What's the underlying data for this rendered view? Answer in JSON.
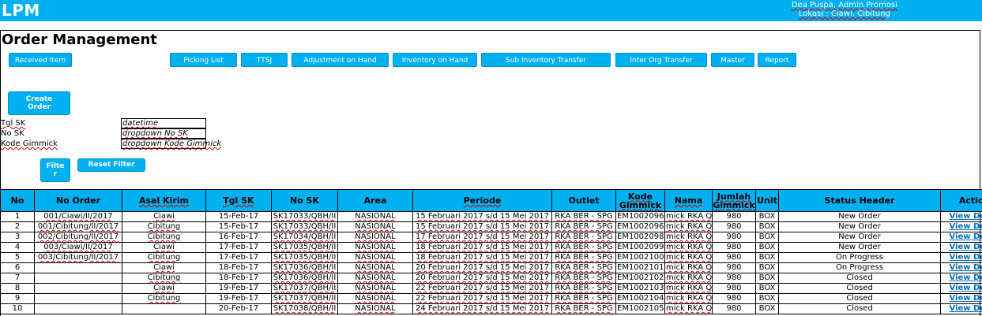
{
  "header": {
    "app_title": "LPM",
    "user_line": "Dea Puspa, Admin Promosi",
    "location_line": "Lokasi : Ciawi, Cibitung"
  },
  "page_title": "Order Management",
  "nav": {
    "received_item": "Received Item",
    "picking_list": "Picking List",
    "ttsj": "TTSJ",
    "adjustment_on_hand": "Adjustment on Hand",
    "inventory_on_hand": "Inventory on Hand",
    "sub_inventory_transfer": "Sub Inventory Transfer",
    "inter_org_transfer": "Inter Org Transfer",
    "master": "Master",
    "report": "Report"
  },
  "create_order": {
    "line1": "Create",
    "line2": "Order"
  },
  "filters": {
    "tgl_sk": {
      "label": "Tgl SK",
      "placeholder": "datetime"
    },
    "no_sk": {
      "label": "No SK",
      "placeholder": "dropdown No SK"
    },
    "kode_gimmick": {
      "label": "Kode Gimmick",
      "placeholder": "dropdown Kode Gimmick"
    },
    "filter_button": {
      "line1": "Filte",
      "line2": "r"
    },
    "reset_button": "Reset Filter"
  },
  "table": {
    "columns": {
      "no": "No",
      "no_order": "No Order",
      "asal_kirim": "Asal Kirim",
      "tgl_sk": "Tgl SK",
      "no_sk": "No SK",
      "area": "Area",
      "periode": "Periode",
      "outlet": "Outlet",
      "kode_gimmick": "Kode Gimmick",
      "nama": "Nama",
      "jumlah_gimmick": "Jumlah Gimmick",
      "unit": "Unit",
      "status_header": "Status Header",
      "action": "Action"
    },
    "rows": [
      {
        "no": "1",
        "no_order": "001/Ciawi/II/2017",
        "asal_kirim": "Ciawi",
        "tgl_sk": "15-Feb-17",
        "no_sk": "SK17033/QBH/II",
        "area": "NASIONAL",
        "periode": "15 Februari 2017 s/d 15 Mei 2017",
        "outlet": "RKA BER - SPG",
        "kode_gimmick": "EM1002096",
        "nama": "mick  RKA  Q",
        "jumlah": "980",
        "unit": "BOX",
        "status": "New Order",
        "action": "View Detail"
      },
      {
        "no": "2",
        "no_order": "001/Cibitung/II/2017",
        "asal_kirim": "Cibitung",
        "tgl_sk": "15-Feb-17",
        "no_sk": "SK17033/QBH/II",
        "area": "NASIONAL",
        "periode": "15 Februari 2017 s/d 15 Mei 2017",
        "outlet": "RKA BER - SPG",
        "kode_gimmick": "EM1002096",
        "nama": "mick  RKA  Q",
        "jumlah": "980",
        "unit": "BOX",
        "status": "New Order",
        "action": "View Detail"
      },
      {
        "no": "3",
        "no_order": "002/Cibitung/II/2017",
        "asal_kirim": "Cibitung",
        "tgl_sk": "16-Feb-17",
        "no_sk": "SK17034/QBH/II",
        "area": "NASIONAL",
        "periode": "17 Februari 2017 s/d 15 Mei 2017",
        "outlet": "RKA BER - SPG",
        "kode_gimmick": "EM1002098",
        "nama": "mick  RKA  Q",
        "jumlah": "980",
        "unit": "BOX",
        "status": "New Order",
        "action": "View Detail"
      },
      {
        "no": "4",
        "no_order": "003/Ciawi/II/2017",
        "asal_kirim": "Ciawi",
        "tgl_sk": "17-Feb-17",
        "no_sk": "SK17035/QBH/II",
        "area": "NASIONAL",
        "periode": "18 Februari 2017 s/d 15 Mei 2017",
        "outlet": "RKA BER - SPG",
        "kode_gimmick": "EM1002099",
        "nama": "mick  RKA  Q",
        "jumlah": "980",
        "unit": "BOX",
        "status": "New Order",
        "action": "View Detail"
      },
      {
        "no": "5",
        "no_order": "003/Cibitung/II/2017",
        "asal_kirim": "Cibitung",
        "tgl_sk": "17-Feb-17",
        "no_sk": "SK17035/QBH/II",
        "area": "NASIONAL",
        "periode": "18 Februari 2017 s/d 15 Mei 2017",
        "outlet": "RKA BER - SPG",
        "kode_gimmick": "EM1002100",
        "nama": "mick  RKA  Q",
        "jumlah": "980",
        "unit": "BOX",
        "status": "On Progress",
        "action": "View Detail"
      },
      {
        "no": "6",
        "no_order": "",
        "asal_kirim": "Ciawi",
        "tgl_sk": "18-Feb-17",
        "no_sk": "SK17036/QBH/II",
        "area": "NASIONAL",
        "periode": "20 Februari 2017 s/d 15 Mei 2017",
        "outlet": "RKA BER - SPG",
        "kode_gimmick": "EM1002101",
        "nama": "mick  RKA  Q",
        "jumlah": "980",
        "unit": "BOX",
        "status": "On Progress",
        "action": "View Detail"
      },
      {
        "no": "7",
        "no_order": "",
        "asal_kirim": "Cibitung",
        "tgl_sk": "18-Feb-17",
        "no_sk": "SK17036/QBH/II",
        "area": "NASIONAL",
        "periode": "20 Februari 2017 s/d 15 Mei 2017",
        "outlet": "RKA BER - SPG",
        "kode_gimmick": "EM1002102",
        "nama": "mick  RKA  Q",
        "jumlah": "980",
        "unit": "BOX",
        "status": "Closed",
        "action": "View Detail"
      },
      {
        "no": "8",
        "no_order": "",
        "asal_kirim": "Ciawi",
        "tgl_sk": "19-Feb-17",
        "no_sk": "SK17037/QBH/II",
        "area": "NASIONAL",
        "periode": "22 Februari 2017 s/d 15 Mei 2017",
        "outlet": "RKA BER - SPG",
        "kode_gimmick": "EM1002103",
        "nama": "mick  RKA  Q",
        "jumlah": "980",
        "unit": "BOX",
        "status": "Closed",
        "action": "View Detail"
      },
      {
        "no": "9",
        "no_order": "",
        "asal_kirim": "Cibitung",
        "tgl_sk": "19-Feb-17",
        "no_sk": "SK17037/QBH/II",
        "area": "NASIONAL",
        "periode": "22 Februari 2017 s/d 15 Mei 2017",
        "outlet": "RKA BER - SPG",
        "kode_gimmick": "EM1002104",
        "nama": "mick  RKA  Q",
        "jumlah": "980",
        "unit": "BOX",
        "status": "Closed",
        "action": "View Detail"
      },
      {
        "no": "10",
        "no_order": "",
        "asal_kirim": "",
        "tgl_sk": "20-Feb-17",
        "no_sk": "SK17038/QBH/II",
        "area": "NASIONAL",
        "periode": "24 Februari 2017 s/d 15 Mei 2017",
        "outlet": "RKA BER - SPG",
        "kode_gimmick": "EM1002105",
        "nama": "mick  RKA  Q",
        "jumlah": "980",
        "unit": "BOX",
        "status": "Closed",
        "action": "View Detail"
      }
    ]
  },
  "colors": {
    "accent": "#00b0f0",
    "link": "#0070c0"
  }
}
